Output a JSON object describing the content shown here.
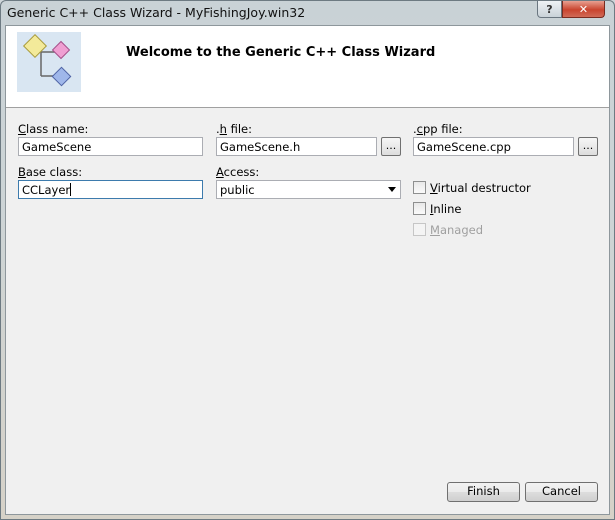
{
  "window": {
    "title": "Generic C++ Class Wizard - MyFishingJoy.win32",
    "help_label": "?",
    "close_label": "✕"
  },
  "header": {
    "title": "Welcome to the Generic C++ Class Wizard",
    "icon": "class-diagram-icon"
  },
  "form": {
    "class_name": {
      "label_mn": "C",
      "label_rest": "lass name:",
      "value": "GameScene"
    },
    "h_file": {
      "label_pre": ".",
      "label_mn": "h",
      "label_rest": " file:",
      "value": "GameScene.h",
      "browse": "..."
    },
    "cpp_file": {
      "label_pre": ".",
      "label_mn": "c",
      "label_rest": "pp file:",
      "value": "GameScene.cpp",
      "browse": "..."
    },
    "base_class": {
      "label_mn": "B",
      "label_rest": "ase class:",
      "value": "CCLayer"
    },
    "access": {
      "label_mn": "A",
      "label_rest": "ccess:",
      "value": "public"
    },
    "virtual_destructor": {
      "label_mn": "V",
      "label_rest": "irtual destructor",
      "checked": false
    },
    "inline": {
      "label_mn": "I",
      "label_rest": "nline",
      "checked": false
    },
    "managed": {
      "label_mn": "M",
      "label_rest": "anaged",
      "checked": false,
      "disabled": true
    }
  },
  "buttons": {
    "finish": "Finish",
    "cancel": "Cancel"
  }
}
